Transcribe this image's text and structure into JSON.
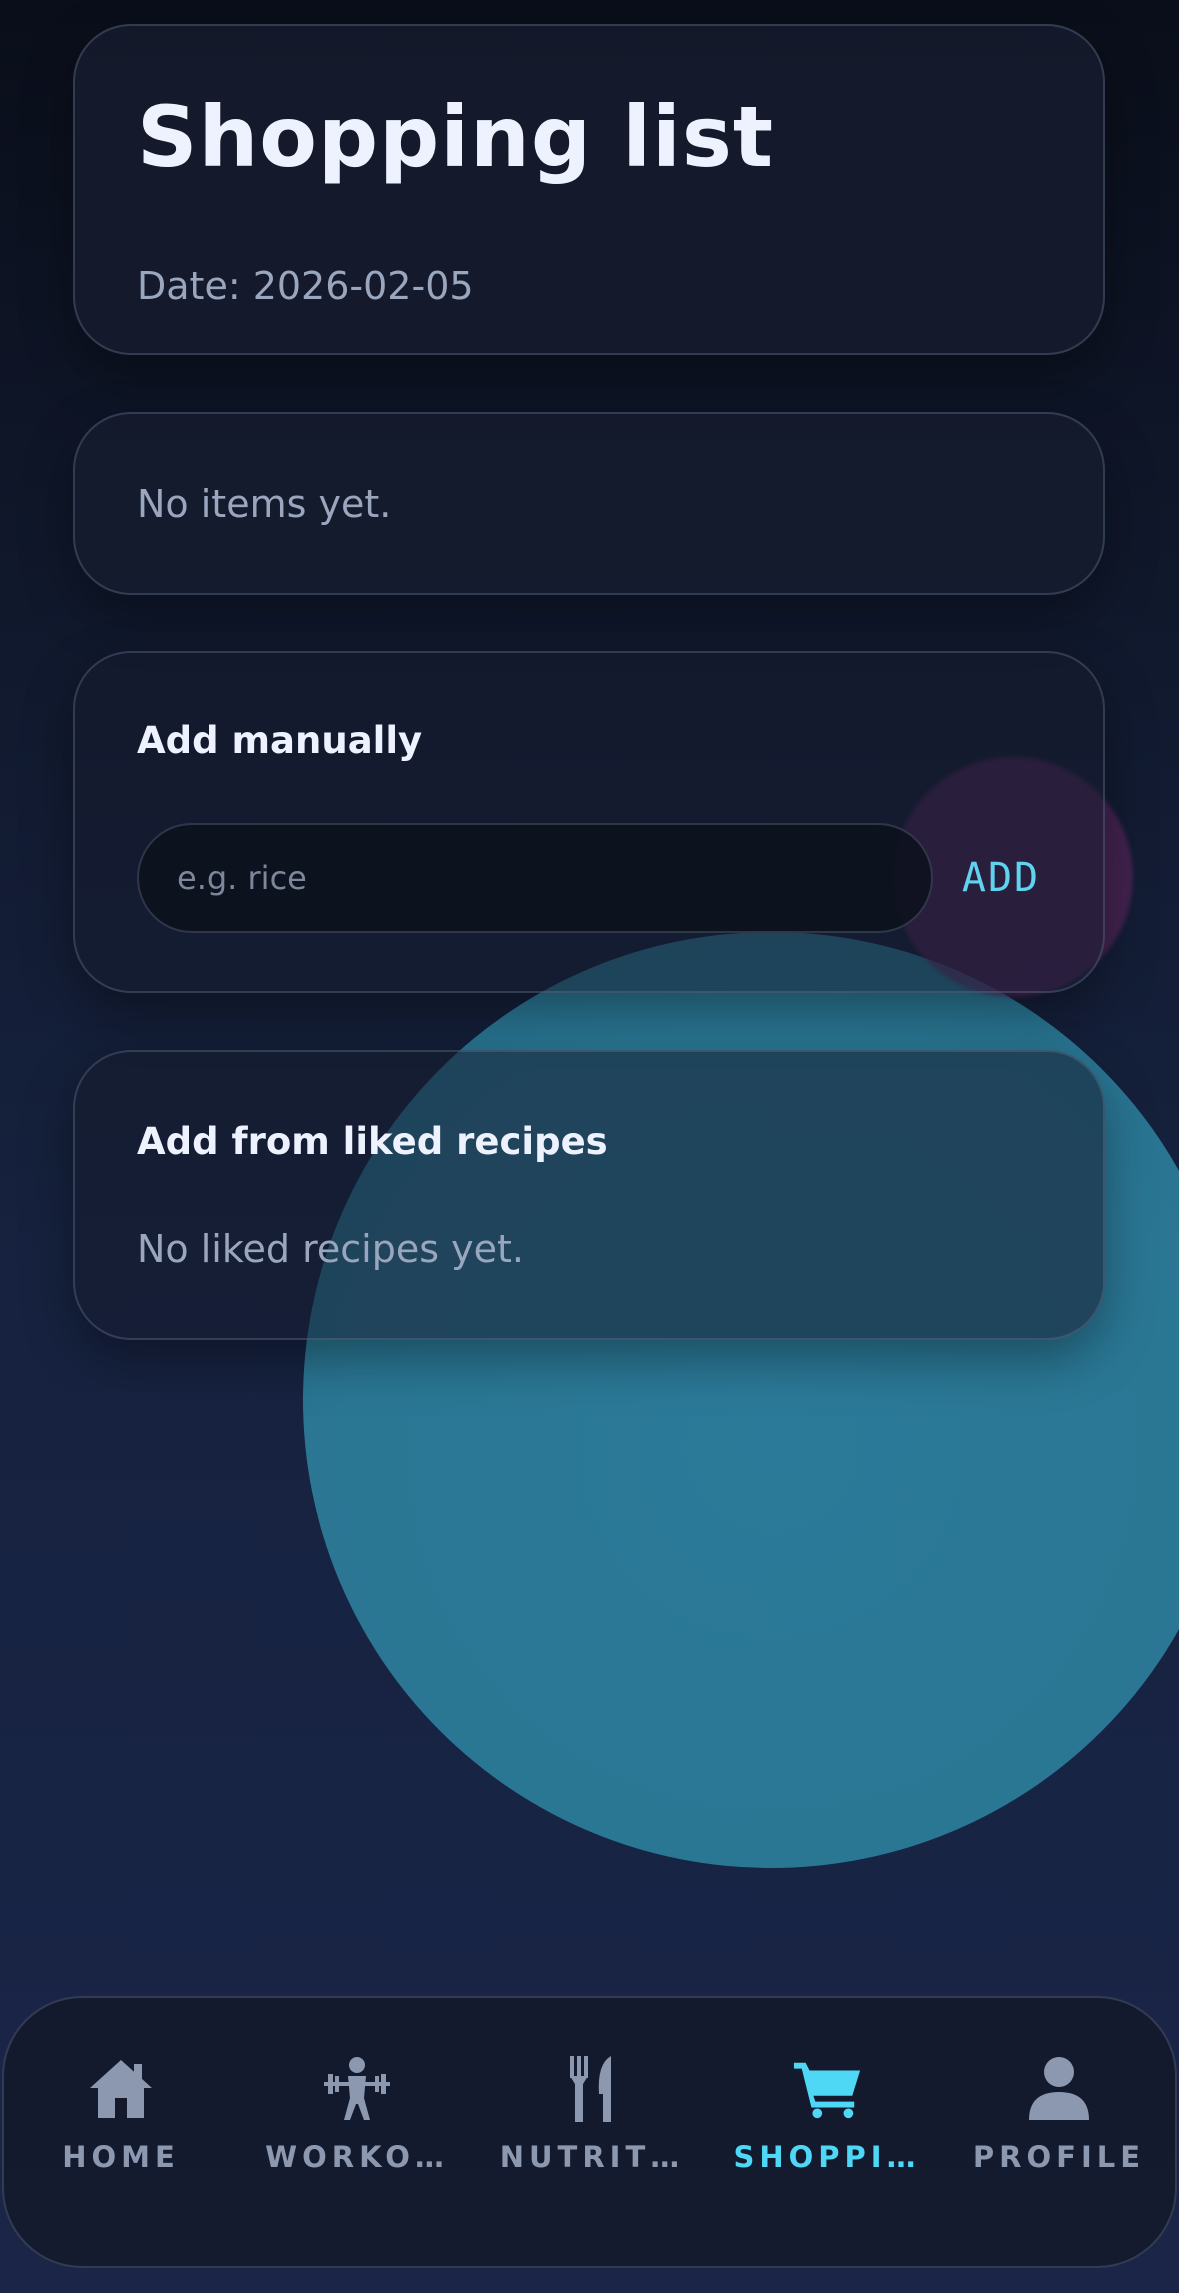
{
  "header": {
    "title": "Shopping list",
    "date": "Date: 2026-02-05"
  },
  "items_card": {
    "empty_text": "No items yet."
  },
  "manual_card": {
    "heading": "Add manually",
    "input_placeholder": "e.g. rice",
    "input_value": "",
    "add_label": "ADD"
  },
  "liked_card": {
    "heading": "Add from liked recipes",
    "empty_text": "No liked recipes yet."
  },
  "nav": {
    "items": [
      {
        "label": "HOME",
        "icon": "home-icon",
        "active": false
      },
      {
        "label": "WORKO…",
        "icon": "weightlifting-icon",
        "active": false
      },
      {
        "label": "NUTRIT…",
        "icon": "fork-knife-icon",
        "active": false
      },
      {
        "label": "SHOPPI…",
        "icon": "cart-icon",
        "active": true
      },
      {
        "label": "PROFILE",
        "icon": "person-icon",
        "active": false
      }
    ]
  },
  "colors": {
    "accent": "#4fd8f5",
    "inactive": "#8c97b0",
    "background": "#0f1628"
  }
}
